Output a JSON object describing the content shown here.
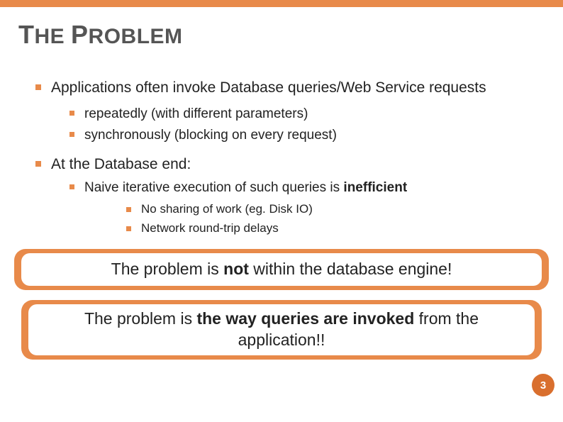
{
  "title_parts": {
    "t1": "T",
    "r1": "HE ",
    "t2": "P",
    "r2": "ROBLEM"
  },
  "bullets": {
    "b1": "Applications often invoke Database queries/Web Service requests",
    "b1a": "repeatedly (with different parameters)",
    "b1b": "synchronously (blocking on every request)",
    "b2": "At the Database end:",
    "b2a_pre": "Naive iterative execution of such queries is ",
    "b2a_bold": "inefficient",
    "b2a_i": "No sharing of work (eg. Disk IO)",
    "b2a_ii": "Network round-trip delays"
  },
  "callout1": {
    "pre": "The problem is ",
    "bold": "not",
    "post": " within the database engine!"
  },
  "callout2": {
    "pre": "The problem is ",
    "bold": "the way queries are invoked",
    "post": " from the application!!"
  },
  "page_number": "3"
}
